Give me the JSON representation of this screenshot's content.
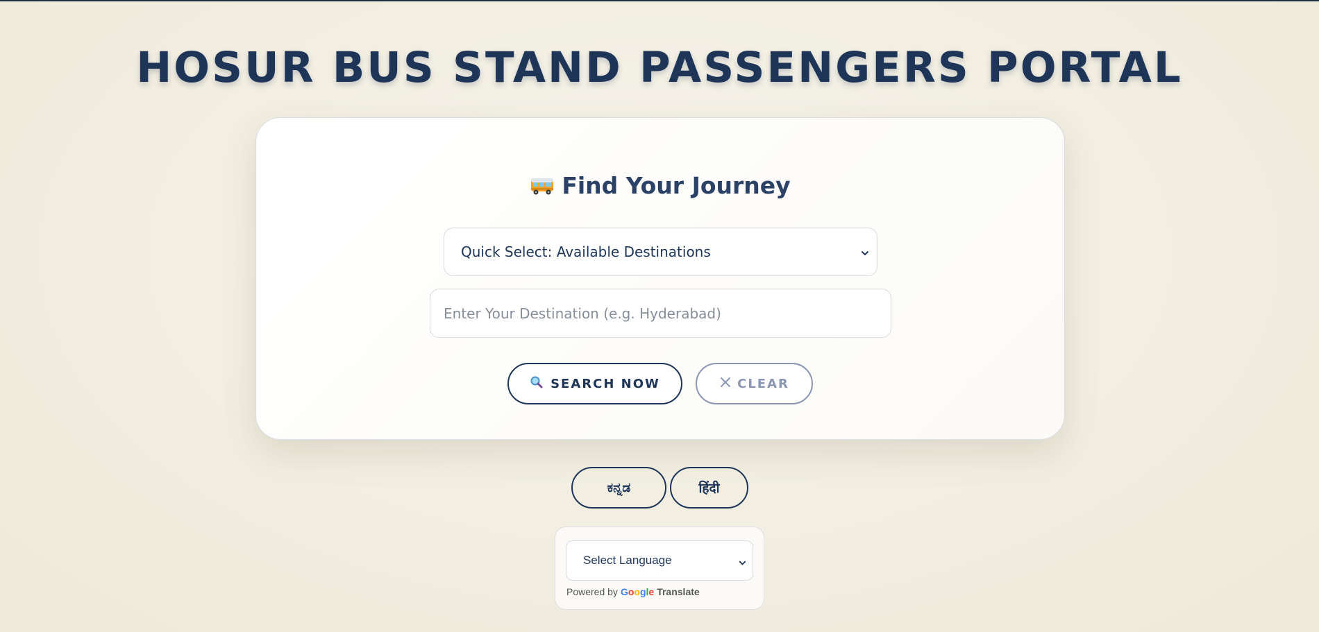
{
  "header": {
    "title": "HOSUR BUS STAND PASSENGERS PORTAL"
  },
  "search_card": {
    "icon": "bus-icon",
    "heading": "Find Your Journey",
    "quick_select": {
      "selected": "Quick Select: Available Destinations"
    },
    "destination_input": {
      "placeholder": "Enter Your Destination (e.g. Hyderabad)",
      "value": ""
    },
    "search_button": {
      "icon": "magnifier-icon",
      "label": "SEARCH NOW"
    },
    "clear_button": {
      "icon": "close-icon",
      "label": "CLEAR"
    }
  },
  "language_buttons": [
    {
      "label": "ಕನ್ನಡ"
    },
    {
      "label": "हिंदी"
    }
  ],
  "google_translate": {
    "select_label": "Select Language",
    "powered_by": "Powered by",
    "google_letters": [
      "G",
      "o",
      "o",
      "g",
      "l",
      "e"
    ],
    "translate_label": "Translate"
  },
  "colors": {
    "primary": "#1e3558",
    "muted": "#8b97b2",
    "background": "#f2eee2"
  }
}
